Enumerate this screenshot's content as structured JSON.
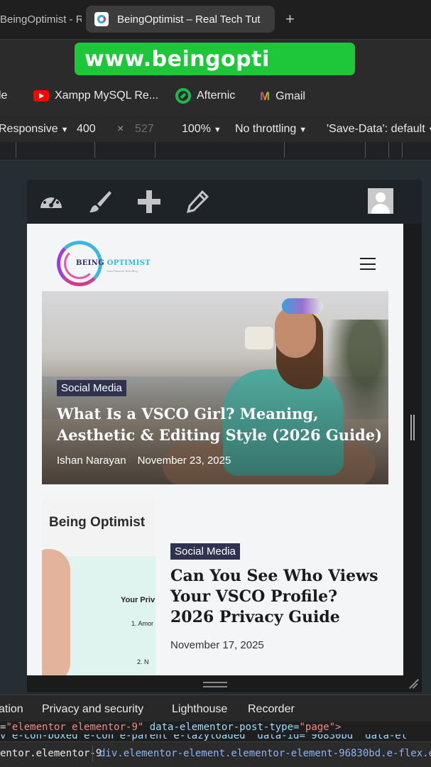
{
  "browser": {
    "tabs": [
      {
        "label": "BeingOptimist - R",
        "active": false
      },
      {
        "label": "BeingOptimist – Real Tech Tut",
        "active": true
      }
    ],
    "url_overlay": "www.beingopti"
  },
  "bookmarks": [
    {
      "label": "le",
      "icon": "google-icon"
    },
    {
      "label": "Xampp MySQL Re...",
      "icon": "youtube-icon"
    },
    {
      "label": "Afternic",
      "icon": "afternic-icon"
    },
    {
      "label": "Gmail",
      "icon": "gmail-icon"
    }
  ],
  "device_toolbar": {
    "mode": "Responsive",
    "width": "400",
    "times": "×",
    "height": "527",
    "zoom": "100%",
    "throttling": "No throttling",
    "save_data": "'Save-Data': default"
  },
  "wp_adminbar": {
    "icons": [
      "dashboard-icon",
      "customize-brush-icon",
      "add-new-icon",
      "edit-pencil-icon",
      "user-avatar"
    ]
  },
  "site": {
    "logo_text_a": "BEING",
    "logo_text_b": "OPTIMIST",
    "logo_tagline": "Solo-Powered Tech Blog"
  },
  "articles": [
    {
      "category": "Social Media",
      "title": "What Is a VSCO Girl? Meaning, Aesthetic & Editing Style (2026 Guide)",
      "author": "Ishan Narayan",
      "date": "November 23, 2025"
    },
    {
      "category": "Social Media",
      "title": "Can You See Who Views Your VSCO Profile? 2026 Privacy Guide",
      "date": "November 17, 2025",
      "thumb_brand": "Being Optimist",
      "thumb_subtitle": "Your Priv",
      "thumb_item1": "1. Amor",
      "thumb_item2": "2. N"
    }
  ],
  "devtools": {
    "tabs": [
      "ation",
      "Privacy and security",
      "Lighthouse",
      "Recorder"
    ],
    "code_attr1_value": "\"elementor elementor-9\"",
    "code_attr2_name": "data-elementor-post-type=",
    "code_attr2_value": "\"page\">",
    "code_partial": "v e-con-boxed e-con e-parent e-lazyloaded\" data-id=\"96830bd\" data-el",
    "breadcrumb_1": "entor.elementor-9",
    "breadcrumb_2": "div.elementor-element.elementor-element-96830bd.e-flex.e-con-b"
  },
  "colors": {
    "url_highlight": "#1ec63a",
    "category_badge": "#2f3350",
    "wp_adminbar": "#1d2327"
  }
}
